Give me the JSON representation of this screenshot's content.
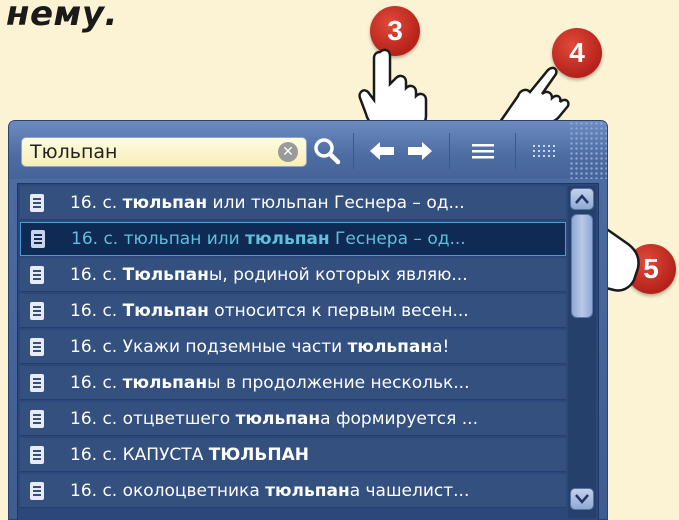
{
  "heading": "нему.",
  "badges": {
    "b3": "3",
    "b4": "4",
    "b5": "5"
  },
  "search": {
    "value": "Тюльпан",
    "clear_icon": "✕"
  },
  "colors": {
    "accent": "#b5221a",
    "selected_text": "#5ec0dc",
    "panel": "#3f5c90"
  },
  "icons": [
    "search-icon",
    "arrow-left-icon",
    "arrow-right-icon",
    "list-view-icon",
    "grid-view-icon"
  ],
  "results": [
    {
      "pre": "16. с. ",
      "b1": "тюльпан",
      "mid": " или тюльпан Геснера – од...",
      "b2": "",
      "post": ""
    },
    {
      "pre": "16. с. тюльпан или ",
      "b1": "тюльпан",
      "mid": " Геснера – од...",
      "b2": "",
      "post": ""
    },
    {
      "pre": "16. с. ",
      "b1": "Тюльпан",
      "mid": "ы, родиной которых являю...",
      "b2": "",
      "post": ""
    },
    {
      "pre": "16. с. ",
      "b1": "Тюльпан",
      "mid": " относится к первым весен...",
      "b2": "",
      "post": ""
    },
    {
      "pre": "16. с. Укажи подземные части ",
      "b1": "тюльпан",
      "mid": "а!",
      "b2": "",
      "post": ""
    },
    {
      "pre": "16. с. ",
      "b1": "тюльпан",
      "mid": "ы в продолжение нескольк...",
      "b2": "",
      "post": ""
    },
    {
      "pre": "16. с. отцветшего ",
      "b1": "тюльпан",
      "mid": "а формируется ...",
      "b2": "",
      "post": ""
    },
    {
      "pre": "16. с. КАПУСТА ",
      "b1": "ТЮЛЬПАН",
      "mid": "",
      "b2": "",
      "post": ""
    },
    {
      "pre": "16. с. околоцветника ",
      "b1": "тюльпан",
      "mid": "а чашелист...",
      "b2": "",
      "post": ""
    }
  ]
}
